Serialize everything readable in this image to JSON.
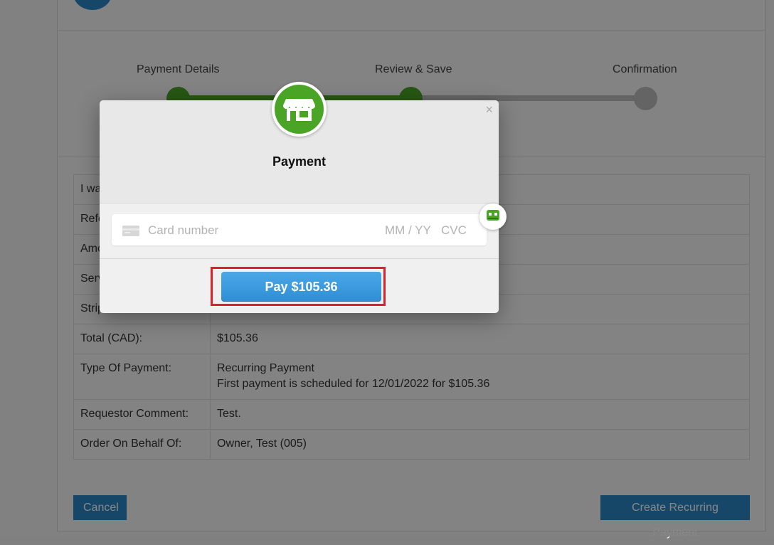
{
  "steps": {
    "labels": [
      "Payment Details",
      "Review & Save",
      "Confirmation"
    ],
    "completed": 2,
    "total": 3
  },
  "summary": {
    "rows": [
      {
        "key": "I wa",
        "value": ""
      },
      {
        "key": "Refe",
        "value": ""
      },
      {
        "key": "Amo",
        "value": ""
      },
      {
        "key": "Serv",
        "value": ""
      },
      {
        "key": "Strip",
        "value": ""
      },
      {
        "key": "Total (CAD):",
        "value": "$105.36"
      },
      {
        "key": "Type Of Payment:",
        "value": "Recurring Payment",
        "value2": "First payment is scheduled for 12/01/2022 for $105.36"
      },
      {
        "key": "Requestor Comment:",
        "value": "Test."
      },
      {
        "key": "Order On Behalf Of:",
        "value": "Owner, Test (005)"
      }
    ]
  },
  "actions": {
    "cancel_label": "Cancel",
    "create_label": "Create Recurring Payment"
  },
  "modal": {
    "title": "Payment",
    "close_glyph": "×",
    "card_number_placeholder": "Card number",
    "expiry_placeholder": "MM / YY",
    "cvc_placeholder": "CVC",
    "pay_label": "Pay $105.36",
    "icons": [
      "store-icon",
      "close-icon",
      "credit-card-icon",
      "robot-autofill-icon"
    ]
  },
  "colors": {
    "accent_blue": "#2b86c5",
    "progress_green": "#4aa526",
    "highlight_red": "#d9222a"
  }
}
